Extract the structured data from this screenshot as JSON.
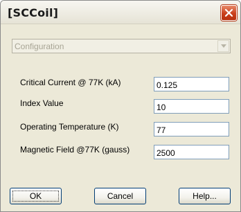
{
  "window": {
    "title": "[SCCoil]",
    "close_icon": "close-x-icon",
    "accent": "#d6451f"
  },
  "configuration": {
    "value": "Configuration",
    "disabled": true
  },
  "fields": [
    {
      "label": "Critical Current @ 77K (kA)",
      "value": "0.125"
    },
    {
      "label": "Index Value",
      "value": "10"
    },
    {
      "label": "Operating Temperature (K)",
      "value": "77"
    },
    {
      "label": "Magnetic Field @77K (gauss)",
      "value": "2500"
    }
  ],
  "buttons": {
    "ok": "OK",
    "cancel": "Cancel",
    "help": "Help..."
  }
}
